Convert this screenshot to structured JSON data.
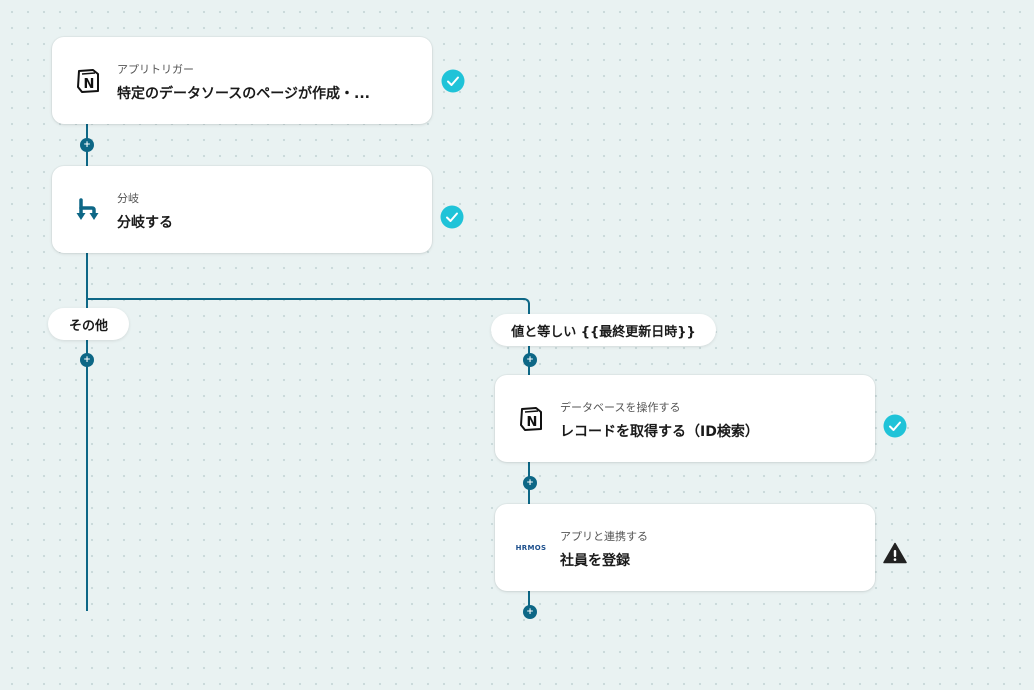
{
  "colors": {
    "accent": "#0d6786",
    "success": "#1fc3d8",
    "warning": "#222222"
  },
  "cards": [
    {
      "subtitle": "アプリトリガー",
      "title": "特定のデータソースのページが作成・...",
      "icon": "notion-icon",
      "status": "success"
    },
    {
      "subtitle": "分岐",
      "title": "分岐する",
      "icon": "branch-icon",
      "status": "success"
    },
    {
      "subtitle": "データベースを操作する",
      "title": "レコードを取得する（ID検索）",
      "icon": "notion-icon",
      "status": "success"
    },
    {
      "subtitle": "アプリと連携する",
      "title": "社員を登録",
      "icon": "hrmos-logo",
      "status": "warning"
    }
  ],
  "branches": {
    "left_label": "その他",
    "right_label": "値と等しい {{最終更新日時}}"
  },
  "hrmos_logo_text": "HRMOS"
}
